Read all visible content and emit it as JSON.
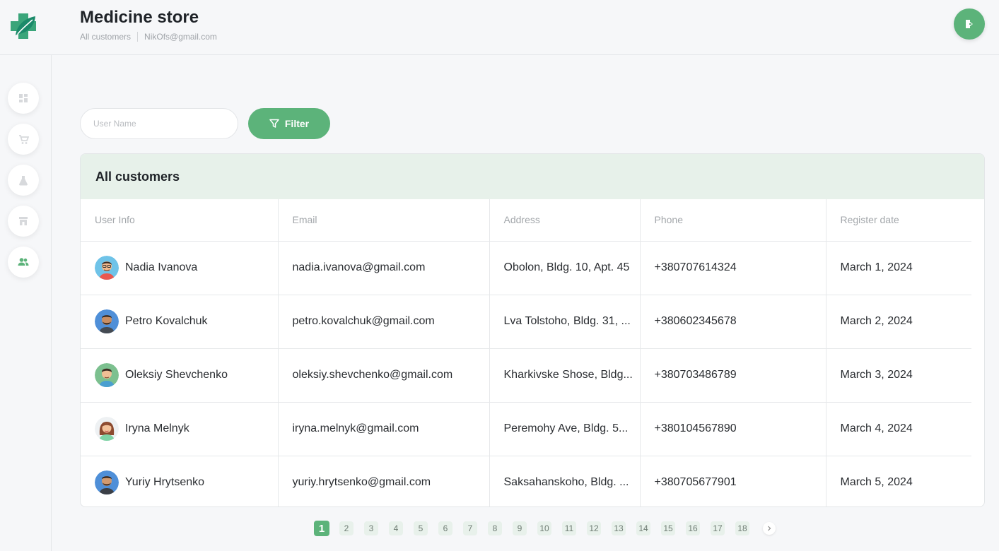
{
  "app": {
    "title": "Medicine store",
    "breadcrumb": [
      "All customers",
      "NikOfs@gmail.com"
    ]
  },
  "sidebar": {
    "items": [
      {
        "icon": "dashboard-icon"
      },
      {
        "icon": "cart-icon"
      },
      {
        "icon": "flask-icon"
      },
      {
        "icon": "store-icon"
      },
      {
        "icon": "users-icon",
        "active": true
      }
    ]
  },
  "filter": {
    "placeholder": "User Name",
    "value": "",
    "button_label": "Filter"
  },
  "customers": {
    "title": "All customers",
    "columns": [
      "User Info",
      "Email",
      "Address",
      "Phone",
      "Register date"
    ],
    "rows": [
      {
        "name": "Nadia Ivanova",
        "email": "nadia.ivanova@gmail.com",
        "address": "Obolon, Bldg. 10, Apt. 45",
        "phone": "+380707614324",
        "date": "March 1, 2024"
      },
      {
        "name": "Petro Kovalchuk",
        "email": "petro.kovalchuk@gmail.com",
        "address": "Lva Tolstoho, Bldg. 31, ...",
        "phone": "+380602345678",
        "date": "March 2, 2024"
      },
      {
        "name": "Oleksiy Shevchenko",
        "email": "oleksiy.shevchenko@gmail.com",
        "address": "Kharkivske Shose, Bldg...",
        "phone": "+380703486789",
        "date": "March 3, 2024"
      },
      {
        "name": "Iryna Melnyk",
        "email": "iryna.melnyk@gmail.com",
        "address": "Peremohy Ave, Bldg. 5...",
        "phone": "+380104567890",
        "date": "March 4, 2024"
      },
      {
        "name": "Yuriy Hrytsenko",
        "email": "yuriy.hrytsenko@gmail.com",
        "address": "Saksahanskoho, Bldg. ...",
        "phone": "+380705677901",
        "date": "March 5, 2024"
      }
    ]
  },
  "pagination": {
    "pages": [
      "1",
      "2",
      "3",
      "4",
      "5",
      "6",
      "7",
      "8",
      "9",
      "10",
      "11",
      "12",
      "13",
      "14",
      "15",
      "16",
      "17",
      "18"
    ],
    "current": "1"
  },
  "colors": {
    "accent": "#5cb37a",
    "card_header": "#e7f1ea"
  }
}
